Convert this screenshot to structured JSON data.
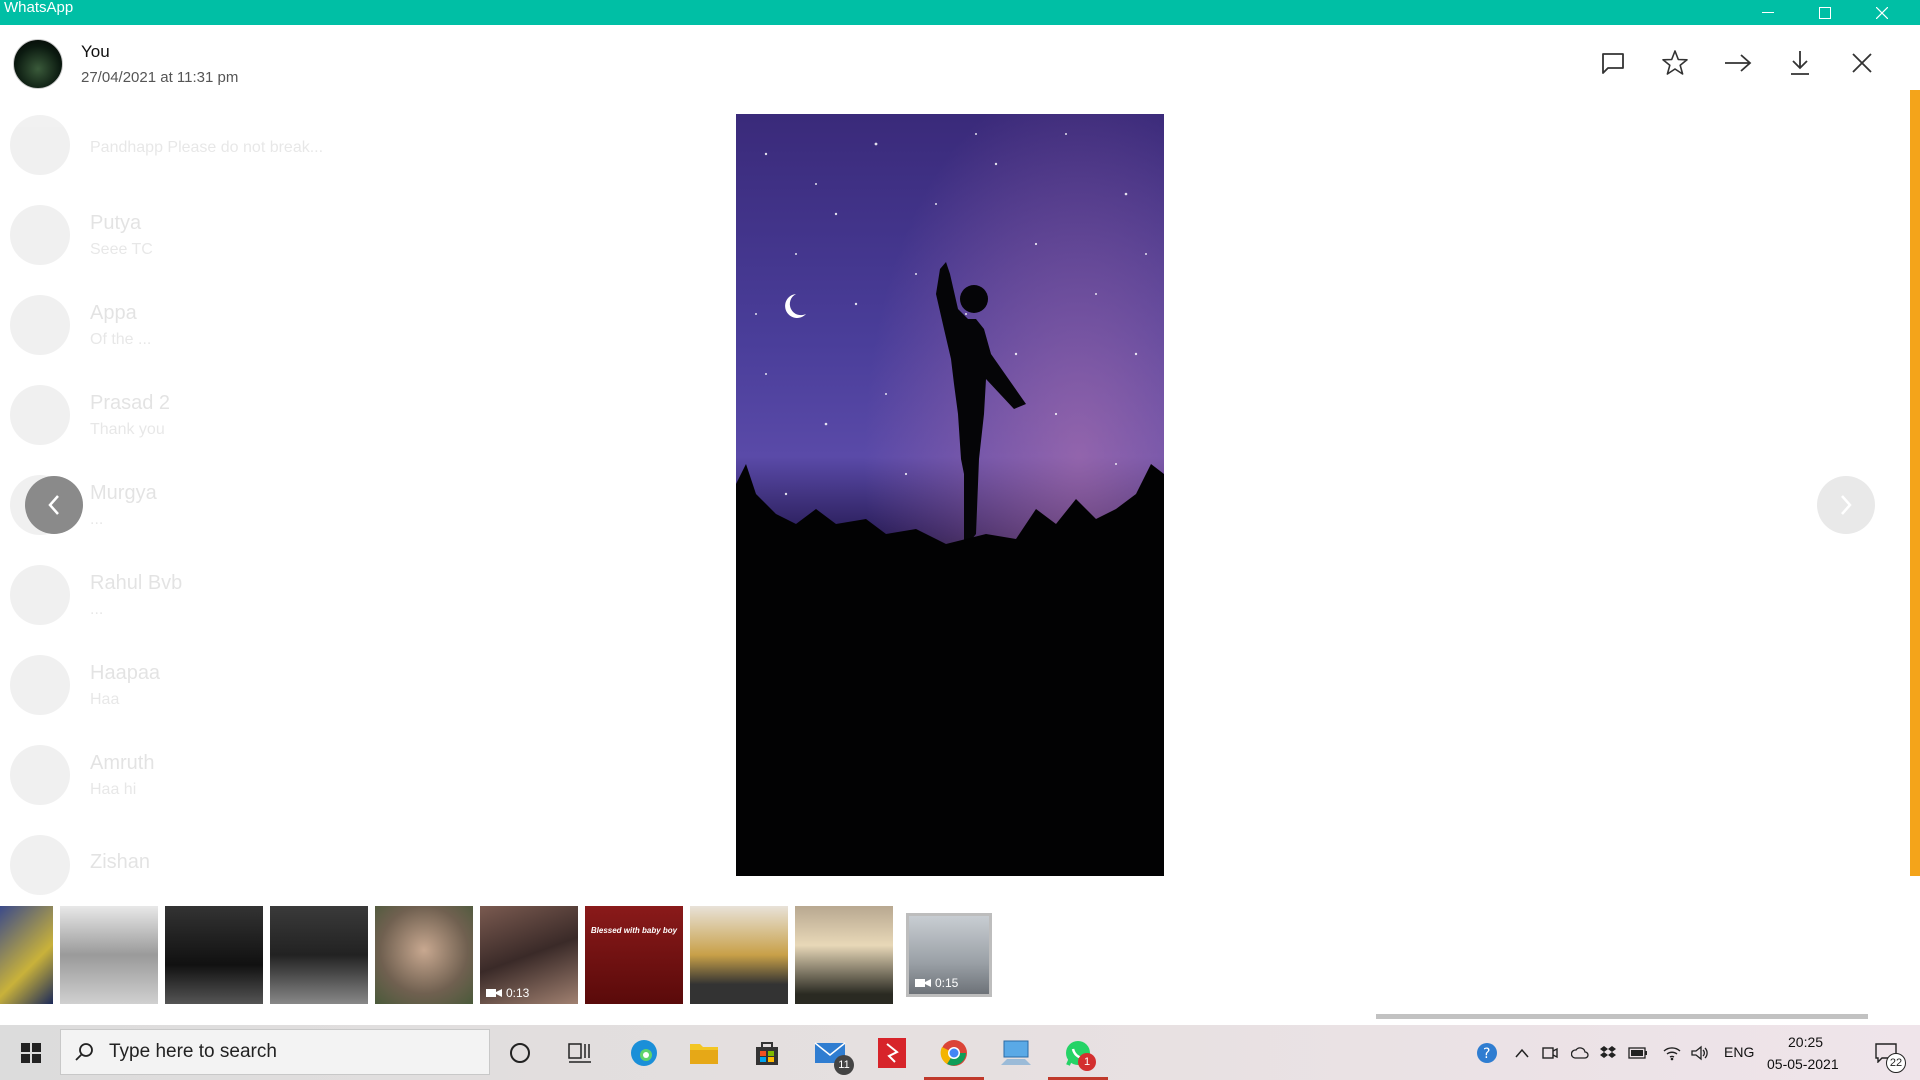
{
  "window": {
    "title": "WhatsApp",
    "accent_color": "#00bfa5"
  },
  "viewer": {
    "sender": "You",
    "timestamp": "27/04/2021 at 11:31 pm",
    "actions": [
      "comment-icon",
      "star-icon",
      "forward-icon",
      "download-icon",
      "close-icon"
    ]
  },
  "background_chats": [
    {
      "name": "",
      "preview": "Pandhapp Please do not break..."
    },
    {
      "name": "Putya",
      "preview": "Seee TC"
    },
    {
      "name": "Appa",
      "preview": "Of the ..."
    },
    {
      "name": "Prasad 2",
      "preview": "Thank you"
    },
    {
      "name": "Murgya",
      "preview": "..."
    },
    {
      "name": "Rahul Bvb",
      "preview": "..."
    },
    {
      "name": "Haapaa",
      "preview": "Haa"
    },
    {
      "name": "Amruth",
      "preview": "Haa hi"
    },
    {
      "name": "Zishan",
      "preview": ""
    }
  ],
  "thumbnails": [
    {
      "kind": "image",
      "duration": ""
    },
    {
      "kind": "image",
      "duration": ""
    },
    {
      "kind": "image",
      "duration": ""
    },
    {
      "kind": "image",
      "duration": ""
    },
    {
      "kind": "image",
      "duration": ""
    },
    {
      "kind": "video",
      "duration": "0:13"
    },
    {
      "kind": "image",
      "duration": "",
      "caption": "Blessed with baby boy"
    },
    {
      "kind": "image",
      "duration": ""
    },
    {
      "kind": "image",
      "duration": ""
    }
  ],
  "selected_thumbnail": {
    "kind": "video",
    "duration": "0:15"
  },
  "taskbar": {
    "search_placeholder": "Type here to search",
    "mail_badge": "11",
    "whatsapp_badge": "1",
    "language": "ENG",
    "time": "20:25",
    "date": "05-05-2021",
    "notifications_badge": "22"
  }
}
